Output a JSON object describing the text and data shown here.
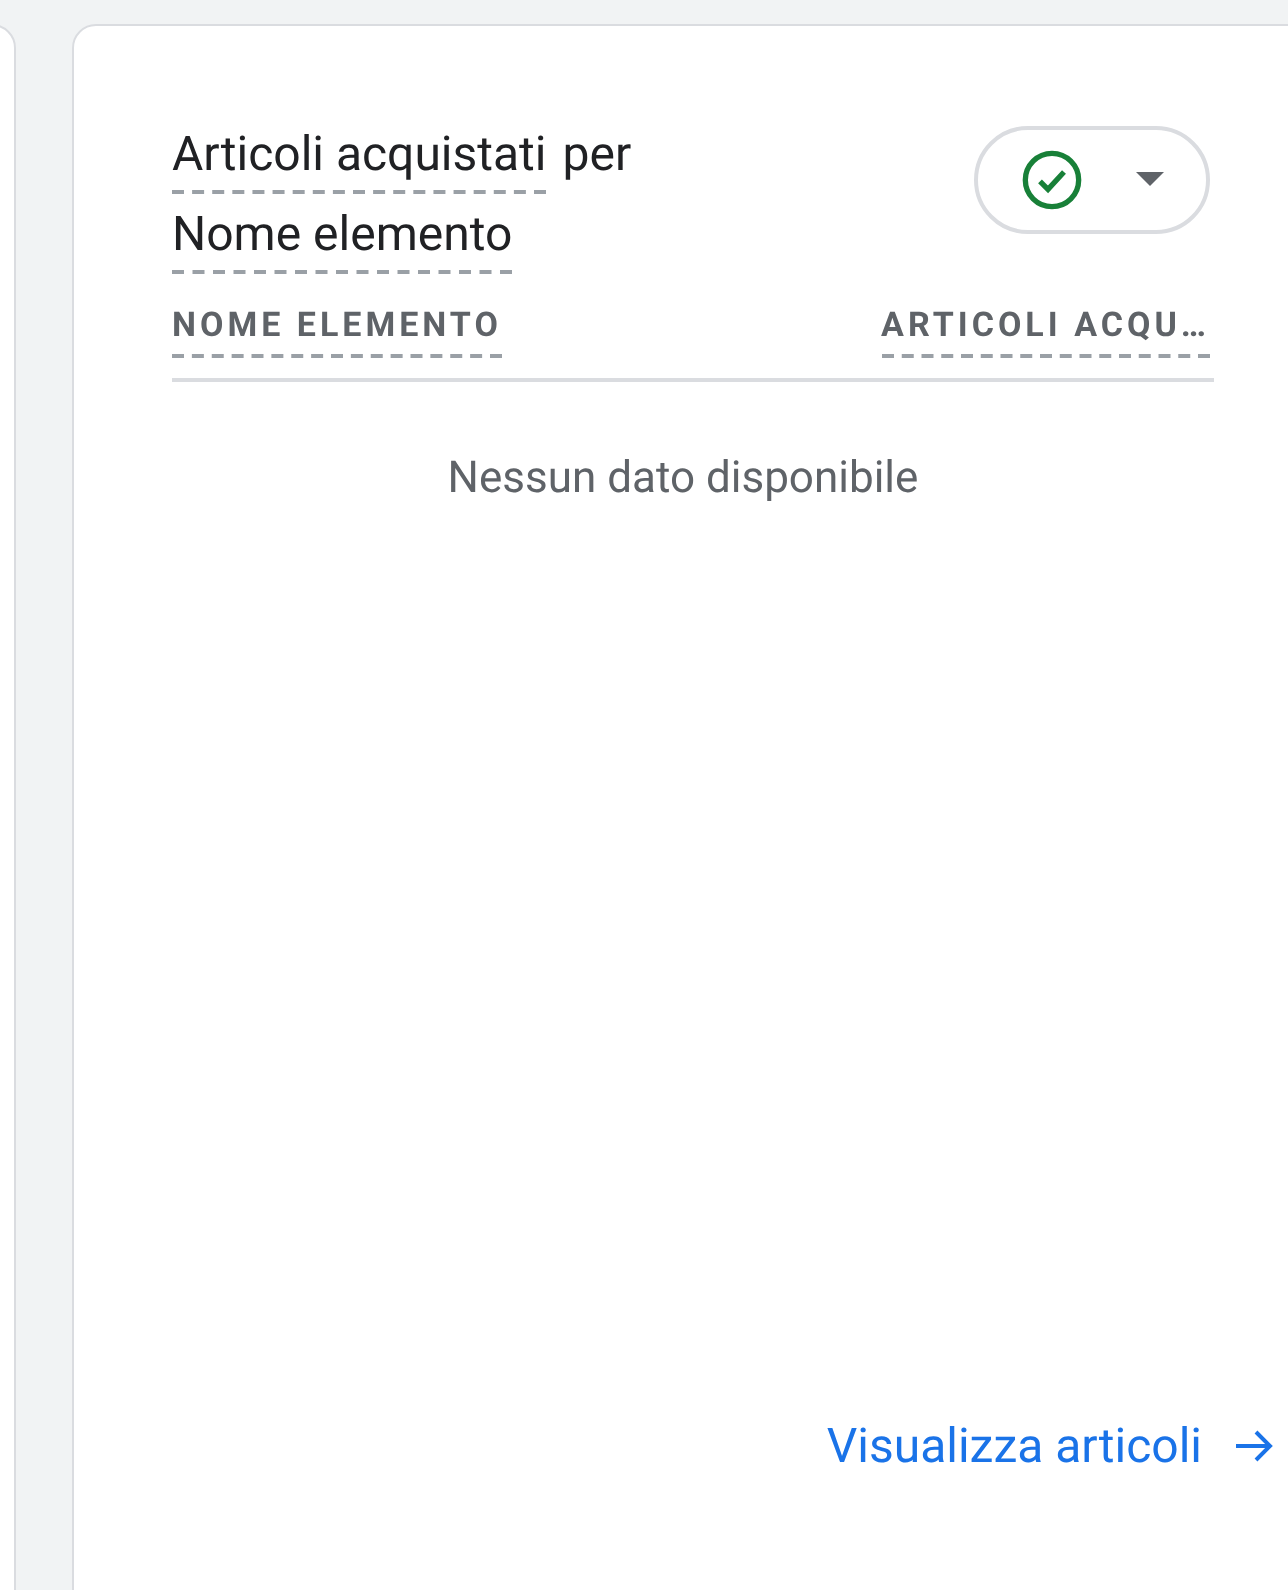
{
  "card": {
    "title": {
      "metric": "Articoli acquistati",
      "connector": "per",
      "dimension": "Nome elemento"
    },
    "status": {
      "ok": true
    },
    "table": {
      "columns": [
        "NOME ELEMENTO",
        "ARTICOLI ACQU…"
      ],
      "empty_message": "Nessun dato disponibile"
    },
    "footer_link": "Visualizza articoli"
  }
}
